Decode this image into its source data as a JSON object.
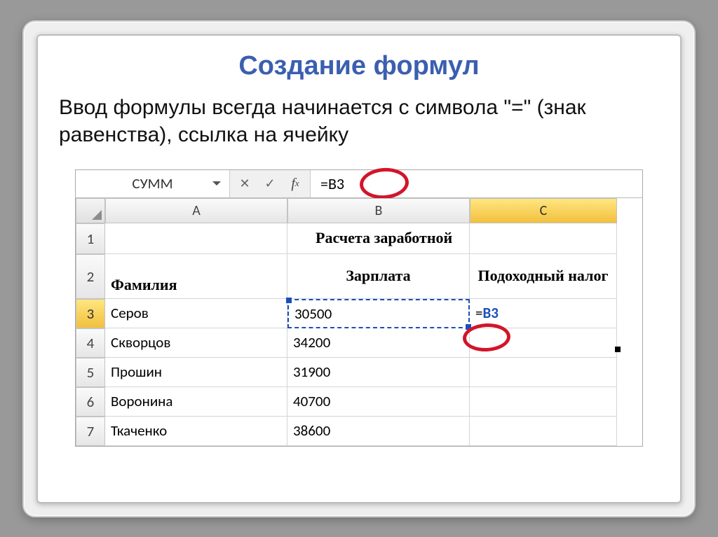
{
  "slide": {
    "title": "Создание формул",
    "description": "Ввод формулы всегда начинается с символа \"=\" (знак равенства), ссылка на ячейку"
  },
  "excel": {
    "namebox": "СУММ",
    "formula": "=B3",
    "columns": {
      "A": "A",
      "B": "B",
      "C": "C"
    },
    "rows": [
      "1",
      "2",
      "3",
      "4",
      "5",
      "6",
      "7"
    ],
    "cells": {
      "B1": "Расчета заработной",
      "A2": "Фамилия",
      "B2": "Зарплата",
      "C2": "Подоходный налог",
      "A3": "Серов",
      "B3": "30500",
      "C3_prefix": "=",
      "C3_ref": "B3",
      "A4": "Скворцов",
      "B4": "34200",
      "A5": "Прошин",
      "B5": "31900",
      "A6": "Воронина",
      "B6": "40700",
      "A7": "Ткаченко",
      "B7": "38600"
    }
  }
}
